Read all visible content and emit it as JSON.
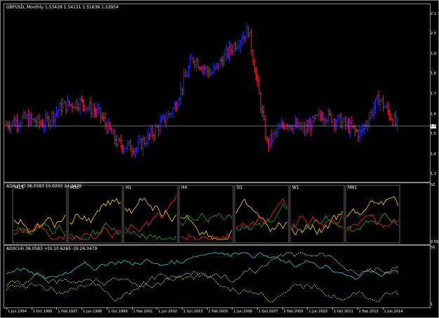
{
  "main_panel": {
    "title": "GBPUSD, Monthly  1.53428 1.54121 1.51636 1.53954",
    "price_labels": [
      "2.1",
      "2.0",
      "1.9",
      "1.8",
      "1.7",
      "1.6",
      "1.5",
      "1.4",
      "1.3"
    ],
    "current_price_label": "1.5"
  },
  "mtf_panel": {
    "title": "ADX (14) 38.0583 10.6265 24.3479",
    "timeframes": [
      "M15",
      "M30",
      "H1",
      "H4",
      "D1",
      "W1",
      "MN1"
    ],
    "scale_top": "50",
    "scale_bottom": "0.56"
  },
  "adx_panel": {
    "title": "ADX(14) 38.0583 +DI:10.6265 -DI:24.3479",
    "scale_top": "56",
    "scale_bottom": "1"
  },
  "date_axis": {
    "labels": [
      "1 Jun 1994",
      "1 Oct 1995",
      "1 Feb 1997",
      "1 Jun 1998",
      "1 Oct 1999",
      "1 Feb 2001",
      "1 Jun 2002",
      "1 Oct 2003",
      "1 Feb 2005",
      "1 Jun 2006",
      "1 Oct 2007",
      "1 Feb 2009",
      "1 Jun 2010",
      "1 Oct 2011",
      "1 Feb 2013",
      "1 Jun 2014"
    ]
  },
  "colors": {
    "bull_bar": "#1f2fff",
    "bear_bar": "#ff2020",
    "adx_line": "#ffd21a",
    "plus_di": "#22a022",
    "minus_di": "#ff1a1a",
    "adx_panel_main": "#1fb4b4",
    "adx_panel_dotted_a": "#e6e640",
    "adx_panel_dotted_b": "#f0f0a0",
    "grid_border": "#8a8a8a"
  },
  "chart_data": {
    "type": "line",
    "title": "GBPUSD, Monthly",
    "ylim": [
      1.28,
      2.12
    ],
    "x": [
      "1994",
      "1995",
      "1996",
      "1997",
      "1998",
      "1999",
      "2000",
      "2001",
      "2002",
      "2003",
      "2004",
      "2005",
      "2006",
      "2007",
      "2008",
      "2009",
      "2010",
      "2011",
      "2012",
      "2013",
      "2014",
      "2015"
    ],
    "series": [
      {
        "name": "GBPUSD",
        "values": [
          1.55,
          1.58,
          1.55,
          1.64,
          1.66,
          1.6,
          1.45,
          1.43,
          1.52,
          1.63,
          1.88,
          1.8,
          1.92,
          2.02,
          1.45,
          1.56,
          1.52,
          1.6,
          1.56,
          1.5,
          1.68,
          1.54
        ]
      }
    ]
  }
}
